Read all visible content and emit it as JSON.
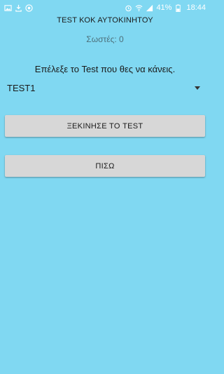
{
  "status_bar": {
    "battery": "41%",
    "time": "18:44",
    "left_icons": [
      "image-icon",
      "download-icon",
      "app-circle-icon"
    ],
    "right_icons": [
      "alarm-icon",
      "wifi-icon",
      "signal-icon",
      "battery-icon"
    ]
  },
  "app": {
    "title": "TEST ΚΟΚ ΑΥΤΟΚΙΝΗΤΟΥ",
    "score_label": "Σωστές: 0",
    "prompt": "Επέλεξε το Test που θες να κάνεις."
  },
  "spinner": {
    "selected": "TEST1"
  },
  "buttons": {
    "start": "ΞΕΚΙΝΗΣΕ ΤΟ TEST",
    "back": "ΠΙΣΩ"
  },
  "colors": {
    "background": "#80d8f2",
    "button": "#d7d7d7"
  }
}
